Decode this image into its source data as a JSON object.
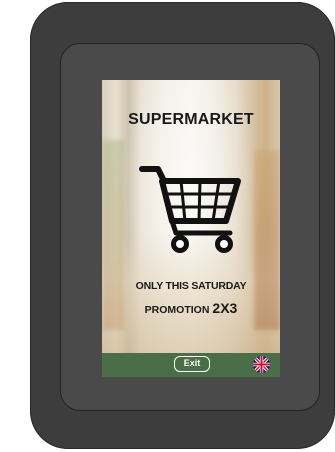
{
  "screen": {
    "title": "SUPERMARKET",
    "promo_line1": "ONLY THIS SATURDAY",
    "promo_word": "PROMOTION",
    "promo_value": "2X3",
    "cart_icon": "shopping-cart-icon"
  },
  "footer": {
    "exit_label": "Exit",
    "language_icon": "uk-flag-icon",
    "background_color": "#4a6e47"
  },
  "colors": {
    "device_body": "#3d3d3d",
    "device_bezel": "#4a4a4a",
    "text": "#1a1a1a"
  }
}
